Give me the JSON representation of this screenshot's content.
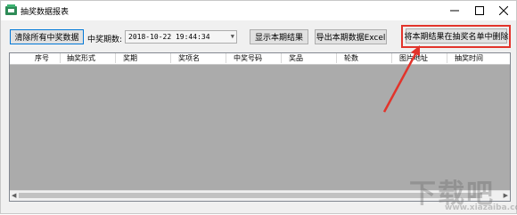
{
  "window": {
    "title": "抽奖数据报表"
  },
  "toolbar": {
    "clear_button": "清除所有中奖数据",
    "period_label": "中奖期数:",
    "period_value": "2018-10-22 19:44:34",
    "show_results_button": "显示本期结果",
    "export_button": "导出本期数据Excel",
    "delete_results_button": "将本期结果在抽奖名单中删除"
  },
  "grid": {
    "columns": [
      "序号",
      "抽奖形式",
      "奖期",
      "奖项名",
      "中奖号码",
      "奖品",
      "轮数",
      "图片地址",
      "抽奖时间"
    ],
    "rows": []
  },
  "watermark": {
    "text": "下载吧",
    "url": "www.xiazaiba.com"
  },
  "colors": {
    "accent": "#0078d7",
    "annotation": "#e2342b",
    "grid_background": "#ababab"
  }
}
